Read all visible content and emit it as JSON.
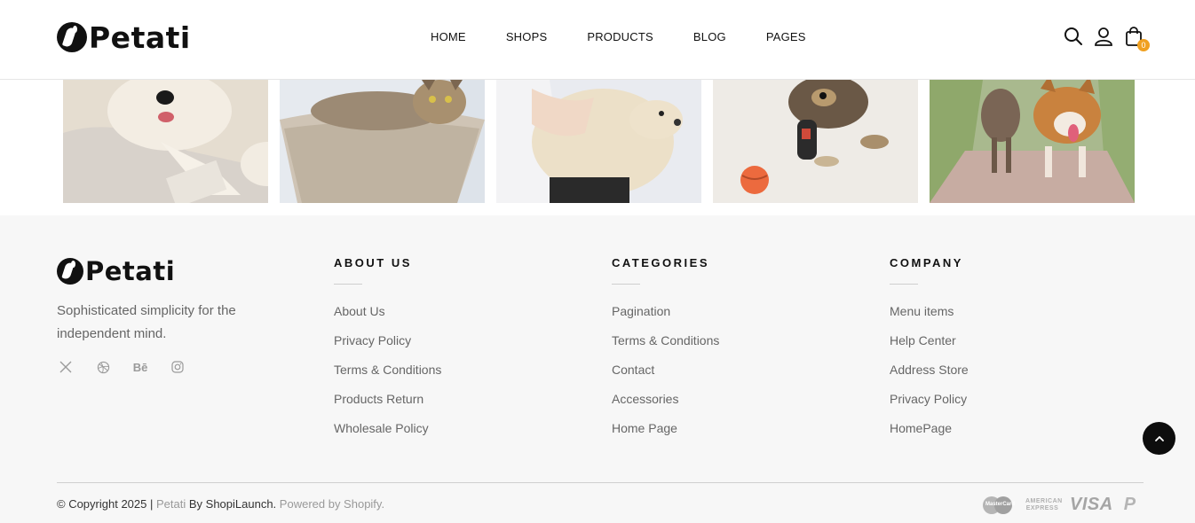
{
  "header": {
    "logo_text": "Petati",
    "nav": [
      "HOME",
      "SHOPS",
      "PRODUCTS",
      "BLOG",
      "PAGES"
    ],
    "cart_count": "0",
    "icons": [
      "search-icon",
      "user-icon",
      "bag-icon"
    ]
  },
  "gallery": {
    "images": [
      "dog-on-bed",
      "cat-in-basket",
      "person-hugging-dog",
      "yorkie-with-ball",
      "dogs-running"
    ]
  },
  "footer": {
    "logo_text": "Petati",
    "tagline": "Sophisticated simplicity for the independent mind.",
    "socials": [
      "x-icon",
      "dribbble-icon",
      "behance-icon",
      "instagram-icon"
    ],
    "behance_label": "Bē",
    "about": {
      "title": "ABOUT US",
      "links": [
        "About Us",
        "Privacy Policy",
        "Terms & Conditions",
        "Products Return",
        "Wholesale Policy"
      ]
    },
    "categories": {
      "title": "CATEGORIES",
      "links": [
        "Pagination",
        "Terms & Conditions",
        "Contact",
        "Accessories",
        "Home Page"
      ]
    },
    "company": {
      "title": "COMPANY",
      "links": [
        "Menu items",
        "Help Center",
        "Address Store",
        "Privacy Policy",
        "HomePage"
      ]
    },
    "copyright": {
      "prefix": "© Copyright 2025 |",
      "brand": "Petati",
      "by": "By",
      "author": "ShopiLaunch.",
      "powered": "Powered by Shopify."
    },
    "payments": {
      "mastercard": "MasterCard",
      "amex_line1": "AMERICAN",
      "amex_line2": "EXPRESS",
      "visa": "VISA",
      "paypal": "P"
    }
  },
  "colors": {
    "accent": "#f0a020",
    "footer_bg": "#f7f7f7",
    "text_muted": "#666666"
  }
}
